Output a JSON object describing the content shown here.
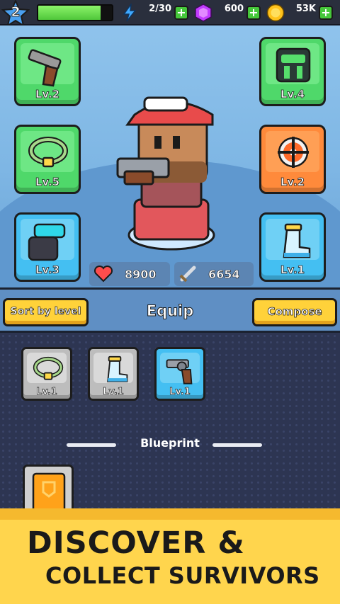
{
  "player": {
    "level": "2",
    "xp_fraction": 0.85
  },
  "resources": {
    "energy": {
      "icon": "lightning-icon",
      "value": "2/30"
    },
    "gems": {
      "icon": "gem-icon",
      "value": "600"
    },
    "coins": {
      "icon": "coin-icon",
      "value": "53K"
    }
  },
  "equipment_slots": [
    {
      "name": "pistol",
      "level": "Lv.2",
      "rarity": "green"
    },
    {
      "name": "armor",
      "level": "Lv.4",
      "rarity": "green"
    },
    {
      "name": "necklace",
      "level": "Lv.5",
      "rarity": "green"
    },
    {
      "name": "ring",
      "level": "Lv.2",
      "rarity": "orange"
    },
    {
      "name": "gloves",
      "level": "Lv.3",
      "rarity": "blue"
    },
    {
      "name": "boots",
      "level": "Lv.1",
      "rarity": "blue"
    }
  ],
  "stats": {
    "health": "8900",
    "attack": "6654"
  },
  "actions": {
    "sort_label": "Sort by level",
    "title": "Equip",
    "compose_label": "Compose"
  },
  "inventory": [
    {
      "name": "necklace",
      "level": "Lv.1",
      "rarity": "grey"
    },
    {
      "name": "boots",
      "level": "Lv.1",
      "rarity": "grey"
    },
    {
      "name": "revolver",
      "level": "Lv.1",
      "rarity": "blue"
    }
  ],
  "blueprint_label": "Blueprint",
  "banner": {
    "line1": "DISCOVER &",
    "line2": "COLLECT SURVIVORS"
  },
  "colors": {
    "common": "#bdbdbd",
    "uncommon": "#4fd86a",
    "rare": "#44bff2",
    "epic": "#ff8a3b",
    "banner": "#ffd54d"
  }
}
